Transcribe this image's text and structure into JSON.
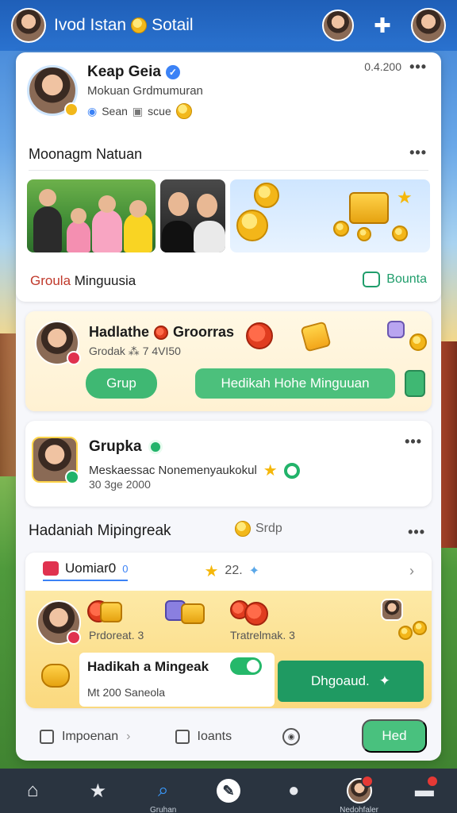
{
  "header": {
    "app_title": "Ivod Istan",
    "app_title_suffix": "Sotail",
    "icons": [
      "avatar",
      "coin-icon",
      "avatar",
      "puzzle-icon",
      "avatar"
    ]
  },
  "profile": {
    "name": "Keap Geia",
    "subtitle": "Mokuan Grdmumuran",
    "meta_text": "Sean",
    "meta_text2": "scue",
    "date": "0.4.200",
    "section_title": "Moonagm Natuan",
    "group_label_red": "Groula",
    "group_label_rest": " Minguusia",
    "bonus_link": "Bounta"
  },
  "reward": {
    "title": "Hadlathe",
    "title_suffix": "Groorras",
    "subtitle": "Grodak ⁂ 7 4VI50",
    "group_button": "Grup",
    "weekly_button": "Hedikah Hohe Minguuan"
  },
  "group_card": {
    "title": "Grupka",
    "description": "Meskaessac Nonemenyaukokul",
    "date": "30 3ge 2000"
  },
  "weekly_section": {
    "title": "Hadaniah Mipingreak",
    "coin_label": "Srdp"
  },
  "weekly_card": {
    "tab_label": "Uomiar0",
    "tab_count": "0",
    "star_count": "22.",
    "label_left": "Prdoreat. 3",
    "label_right": "Tratrelmak. 3",
    "box_title": "Hadikah a Mingeak",
    "box_subtitle": "Mt 200 Saneola",
    "cta": "Dhgoaud."
  },
  "actions": {
    "item1": "Impoenan",
    "item2": "Ioants",
    "send": "Hed"
  },
  "bottom_nav": {
    "search_label": "Gruhan",
    "profile_label": "Nedohfaler"
  },
  "colors": {
    "primary_blue": "#2a72cf",
    "accent_green": "#3fb873",
    "nav_bg": "#2a3440",
    "alert_red": "#e53935"
  }
}
